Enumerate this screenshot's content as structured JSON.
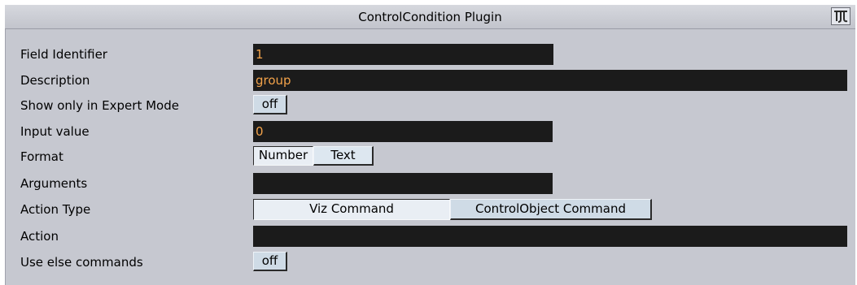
{
  "window": {
    "title": "ControlCondition Plugin",
    "icon": "plugin-logo-icon"
  },
  "fields": {
    "field_identifier": {
      "label": "Field Identifier",
      "value": "1"
    },
    "description": {
      "label": "Description",
      "value": "group"
    },
    "expert_mode": {
      "label": "Show only in Expert Mode",
      "toggle": "off"
    },
    "input_value": {
      "label": "Input value",
      "value": "0"
    },
    "format": {
      "label": "Format",
      "options": [
        "Number",
        "Text"
      ],
      "selected": "Text"
    },
    "arguments": {
      "label": "Arguments",
      "value": ""
    },
    "action_type": {
      "label": "Action Type",
      "options": [
        "Viz Command",
        "ControlObject Command"
      ],
      "selected": "Viz Command"
    },
    "action": {
      "label": "Action",
      "value": ""
    },
    "use_else": {
      "label": "Use else commands",
      "toggle": "off"
    }
  },
  "colors": {
    "panel_bg": "#c6c8d0",
    "field_bg": "#1b1b1b",
    "field_text": "#f2a24a",
    "button_bg": "#cfdbe6"
  }
}
